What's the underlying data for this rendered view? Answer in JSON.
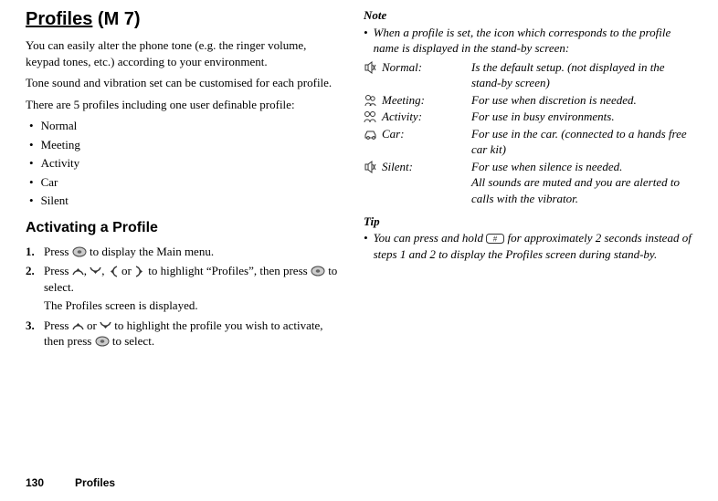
{
  "footer": {
    "page": "130",
    "section": "Profiles"
  },
  "left": {
    "title_main": "Profiles",
    "title_suffix": " (M 7)",
    "para1": "You can easily alter the phone tone (e.g. the ringer volume, keypad tones, etc.) according to your environment.",
    "para2": "Tone sound and vibration set can be customised for each profile.",
    "para3": "There are 5 profiles including one user definable profile:",
    "bullets": [
      "Normal",
      "Meeting",
      "Activity",
      "Car",
      "Silent"
    ],
    "activating_heading": "Activating a Profile",
    "step1_a": "Press ",
    "step1_b": " to display the Main menu.",
    "step2_a": "Press ",
    "step2_b": " or ",
    "step2_c": " to highlight “Profiles”, then press ",
    "step2_d": " to select.",
    "step2_note": "The Profiles screen is displayed.",
    "step3_a": "Press ",
    "step3_b": " or ",
    "step3_c": " to highlight the profile you wish to activate, then press ",
    "step3_d": " to select.",
    "comma": ", "
  },
  "right": {
    "note_heading": "Note",
    "note_line": "When a profile is set, the icon which corresponds to the profile name is displayed in the stand-by screen:",
    "rows": [
      {
        "icon": "speaker-mute",
        "label": "Normal:",
        "desc": "Is the default setup. (not displayed in the stand-by screen)"
      },
      {
        "icon": "meeting",
        "label": "Meeting:",
        "desc": "For use when discretion is needed."
      },
      {
        "icon": "activity",
        "label": "Activity:",
        "desc": "For use in busy environments."
      },
      {
        "icon": "car",
        "label": "Car:",
        "desc": "For use in the car. (connected to a hands free car kit)"
      },
      {
        "icon": "silent",
        "label": "Silent:",
        "desc": "For use when silence is needed.\nAll sounds are muted and you are alerted to calls with the vibrator."
      }
    ],
    "tip_heading": "Tip",
    "tip_a": "You can press and hold ",
    "tip_b": " for approximately 2 seconds instead of steps 1 and 2 to display the Profiles screen during stand-by."
  }
}
